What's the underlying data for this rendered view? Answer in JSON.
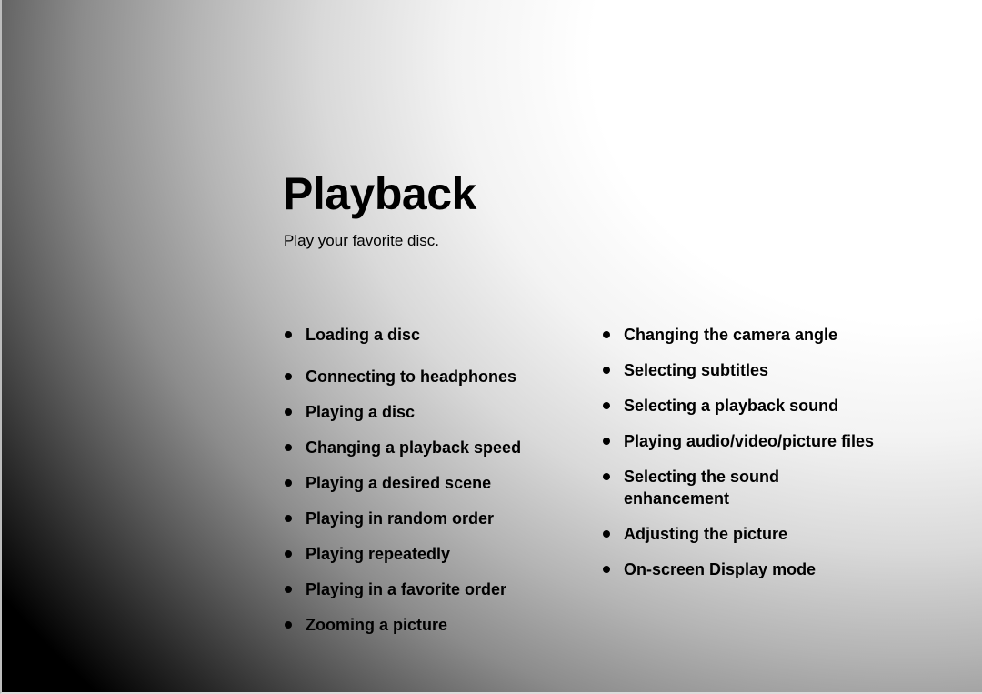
{
  "page": {
    "title": "Playback",
    "subtitle": "Play your favorite disc."
  },
  "topics": {
    "left": [
      {
        "label": "Loading a disc",
        "icon": "bullet-icon"
      },
      {
        "label": "Connecting to headphones",
        "icon": "bullet-icon"
      },
      {
        "label": "Playing a disc",
        "icon": "bullet-icon"
      },
      {
        "label": "Changing a playback speed",
        "icon": "bullet-icon"
      },
      {
        "label": "Playing a desired scene",
        "icon": "bullet-icon"
      },
      {
        "label": "Playing in random order",
        "icon": "bullet-icon"
      },
      {
        "label": "Playing repeatedly",
        "icon": "bullet-icon"
      },
      {
        "label": "Playing in a favorite order",
        "icon": "bullet-icon"
      },
      {
        "label": "Zooming a picture",
        "icon": "bullet-icon"
      }
    ],
    "right": [
      {
        "label": "Changing the camera angle",
        "icon": "bullet-icon"
      },
      {
        "label": "Selecting subtitles",
        "icon": "bullet-icon"
      },
      {
        "label": "Selecting a playback sound",
        "icon": "bullet-icon"
      },
      {
        "label": "Playing audio/video/picture files",
        "icon": "bullet-icon"
      },
      {
        "label": "Selecting the sound enhancement",
        "icon": "bullet-icon"
      },
      {
        "label": "Adjusting the picture",
        "icon": "bullet-icon"
      },
      {
        "label": "On-screen Display mode",
        "icon": "bullet-icon"
      }
    ]
  },
  "colors": {
    "text": "#000000",
    "background_light": "#ffffff",
    "background_dark": "#000000"
  }
}
